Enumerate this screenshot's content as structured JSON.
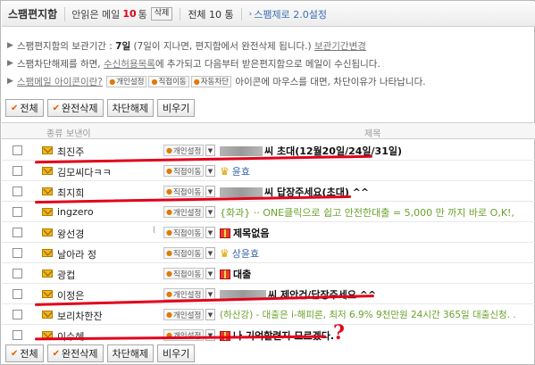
{
  "header": {
    "title": "스팸편지함",
    "unread_prefix": "안읽은 메일",
    "unread_count": "10",
    "unread_unit": "통",
    "delete_label": "삭제",
    "total_text": "전체 10 통",
    "settings_link": "스팸제로 2.0설정"
  },
  "info": {
    "line1_a": "스팸편지함의 보관기간 :",
    "line1_b": "7일",
    "line1_c": "(7일이 지나면, 편지함에서 완전삭제 됩니다.)",
    "line1_link": "보관기간변경",
    "line2_a": "스팸차단해제를 하면,",
    "line2_link": "수신허용목록",
    "line2_b": "에 추가되고 다음부터 받은편지함으로 메일이 수신됩니다.",
    "line3_link": "스팸메일 아이콘이란?",
    "line3_tags": [
      "개인설정",
      "직접이동",
      "자동차단"
    ],
    "line3_b": "아이콘에 마우스를 대면, 차단이유가 나타납니다."
  },
  "toolbar": {
    "all": "전체",
    "delete_perm": "완전삭제",
    "unblock": "차단해제",
    "empty": "비우기"
  },
  "table": {
    "col_kind": "종류",
    "col_sender": "보낸이",
    "col_subject": "제목"
  },
  "rows": [
    {
      "sender": "최진주",
      "tag": "개인설정",
      "subject": "씨 초대(12월20일/24일/31일)"
    },
    {
      "sender": "김모씨다ㅋㅋ",
      "tag": "직접이동",
      "subject": "윤효"
    },
    {
      "sender": "최지희",
      "tag": "직접이동",
      "subject": "씨 답장주세요(초대) ^^"
    },
    {
      "sender": "ingzero",
      "tag": "개인설정",
      "subject": "{화과} ·· ONE클릭으로 쉽고 안전한대출 = 5,000 만 까지 바로 O,K!,"
    },
    {
      "sender": "왕선경",
      "tag": "직접이동",
      "subject": "제목없음"
    },
    {
      "sender": "날아라 정",
      "tag": "직접이동",
      "subject": "상윤효"
    },
    {
      "sender": "광컵",
      "tag": "직접이동",
      "subject": "대출"
    },
    {
      "sender": "이정은",
      "tag": "개인설정",
      "subject": "씨 제안건/답장주세요 ^^"
    },
    {
      "sender": "보리차한잔",
      "tag": "개인설정",
      "subject": "(하산강) - 대출은 i-해피론, 최저 6.9% 9천만원 24시간 365일 대출신청. ."
    },
    {
      "sender": "이수혜",
      "tag": "개인설정",
      "subject": "나 기억할련지 모르겠다."
    }
  ],
  "annotation": {
    "question_mark": "?",
    "color": "#e3001b"
  }
}
